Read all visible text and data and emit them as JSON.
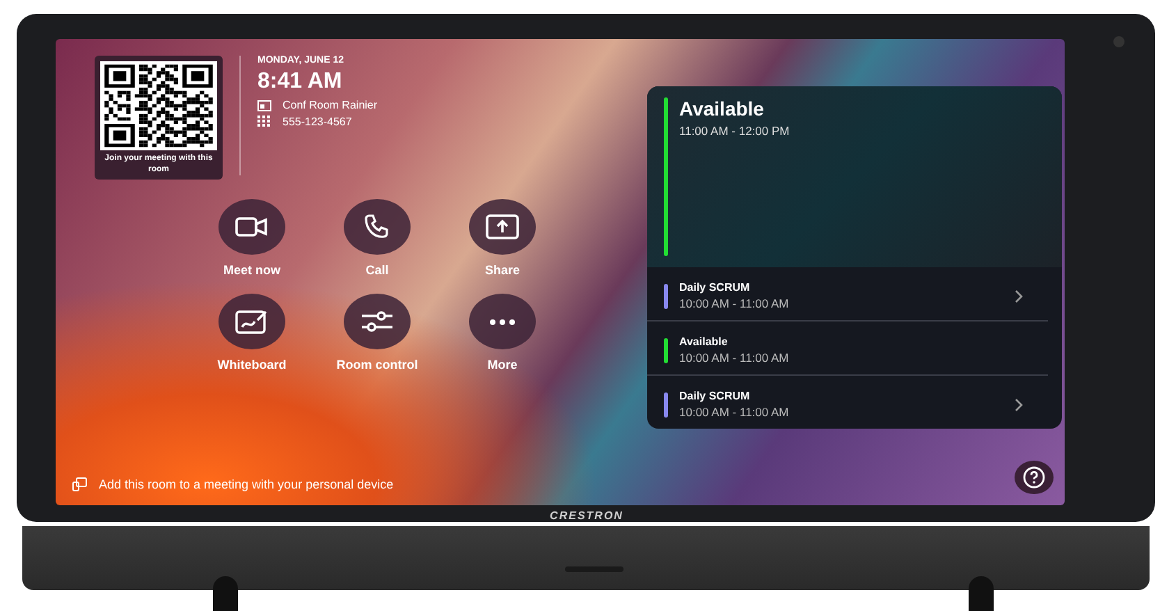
{
  "room_info": {
    "qr_caption": "Join your meeting with this room",
    "date": "MONDAY, JUNE 12",
    "time": "8:41 AM",
    "room_name": "Conf Room Rainier",
    "phone": "555-123-4567"
  },
  "actions": [
    {
      "kind": "video",
      "label": "Meet now"
    },
    {
      "kind": "phone",
      "label": "Call"
    },
    {
      "kind": "share",
      "label": "Share"
    },
    {
      "kind": "whiteboard",
      "label": "Whiteboard"
    },
    {
      "kind": "sliders",
      "label": "Room control"
    },
    {
      "kind": "more",
      "label": "More"
    }
  ],
  "current": {
    "status": "Available",
    "time": "11:00 AM - 12:00 PM",
    "color": "#22dd33"
  },
  "schedule": [
    {
      "kind": "meeting",
      "title": "Daily SCRUM",
      "time": "10:00 AM - 11:00 AM",
      "color": "#8888ee"
    },
    {
      "kind": "free",
      "title": "Available",
      "time": "10:00 AM - 11:00 AM",
      "color": "#22dd33"
    },
    {
      "kind": "meeting",
      "title": "Daily SCRUM",
      "time": "10:00 AM - 11:00 AM",
      "color": "#8888ee"
    }
  ],
  "footer": {
    "text": "Add this room to a meeting with your personal device"
  },
  "brand": "CRESTRON"
}
